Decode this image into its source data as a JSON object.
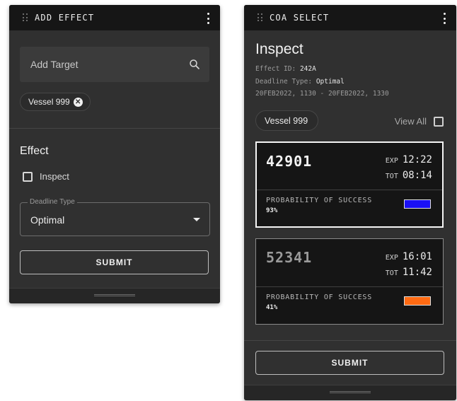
{
  "left_panel": {
    "title": "ADD EFFECT",
    "search": {
      "placeholder": "Add Target",
      "value": ""
    },
    "target_chip": "Vessel 999",
    "section_title": "Effect",
    "checkbox_label": "Inspect",
    "checkbox_checked": false,
    "deadline": {
      "label": "Deadline Type",
      "value": "Optimal"
    },
    "submit_label": "SUBMIT"
  },
  "right_panel": {
    "title": "COA SELECT",
    "heading": "Inspect",
    "effect_id_label": "Effect ID:",
    "effect_id_value": "242A",
    "deadline_type_label": "Deadline Type:",
    "deadline_type_value": "Optimal",
    "time_window": "20FEB2022, 1130 - 20FEB2022, 1330",
    "target_chip": "Vessel 999",
    "view_all_label": "View All",
    "view_all_checked": false,
    "coas": [
      {
        "id": "42901",
        "exp_label": "EXP",
        "exp": "12:22",
        "tot_label": "TOT",
        "tot": "08:14",
        "pos_label": "PROBABILITY OF SUCCESS",
        "pos": "93%",
        "color": "#1a10f5",
        "selected": true
      },
      {
        "id": "52341",
        "exp_label": "EXP",
        "exp": "16:01",
        "tot_label": "TOT",
        "tot": "11:42",
        "pos_label": "PROBABILITY OF SUCCESS",
        "pos": "41%",
        "color": "#ff6a12",
        "selected": false
      }
    ],
    "submit_label": "SUBMIT"
  }
}
